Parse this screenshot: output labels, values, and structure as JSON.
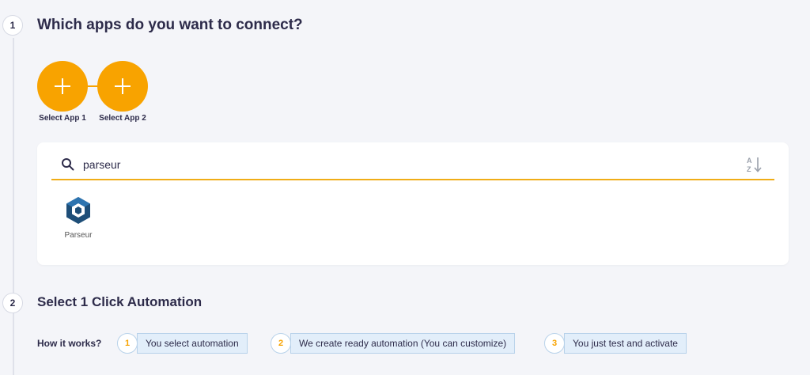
{
  "step1": {
    "number": "1",
    "title": "Which apps do you want to connect?"
  },
  "apps": {
    "app1_label": "Select App 1",
    "app2_label": "Select App 2"
  },
  "search": {
    "value": "parseur"
  },
  "results": [
    {
      "name": "Parseur",
      "logo": "parseur-logo-icon"
    }
  ],
  "step2": {
    "number": "2",
    "title": "Select 1 Click Automation"
  },
  "how_it_works": {
    "label": "How it works?",
    "steps": [
      {
        "number": "1",
        "text": "You select automation"
      },
      {
        "number": "2",
        "text": "We create ready automation (You can customize)"
      },
      {
        "number": "3",
        "text": "You just test and activate"
      }
    ]
  },
  "colors": {
    "accent": "#f8a300",
    "underline": "#f0ad17",
    "step_bg": "#e2eefa",
    "background": "#f4f5f9"
  }
}
